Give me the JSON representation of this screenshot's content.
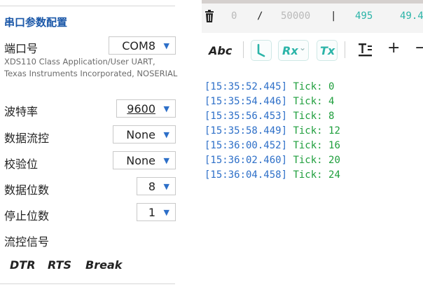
{
  "panel": {
    "title": "串口参数配置",
    "port": {
      "label": "端口号",
      "value": "COM8",
      "description": "XDS110 Class Application/User UART, Texas Instruments Incorporated, NOSERIAL"
    },
    "baud": {
      "label": "波特率",
      "value": "9600"
    },
    "flow_control": {
      "label": "数据流控",
      "value": "None"
    },
    "parity": {
      "label": "校验位",
      "value": "None"
    },
    "data_bits": {
      "label": "数据位数",
      "value": "8"
    },
    "stop_bits": {
      "label": "停止位数",
      "value": "1"
    },
    "flow_signals": {
      "label": "流控信号",
      "dtr": "DTR",
      "rts": "RTS",
      "break": "Break"
    }
  },
  "status": {
    "rx_count": "0",
    "slash": "/",
    "limit": "50000",
    "divider": "|",
    "tx_count": "495",
    "rate": "49.4"
  },
  "toolbar": {
    "abc": "Abc",
    "rx": "Rx",
    "rx_arrow": "⌄",
    "tx": "Tx",
    "plus": "+",
    "minus": "−"
  },
  "log": [
    {
      "ts": "[15:35:52.445]",
      "msg": "Tick: 0"
    },
    {
      "ts": "[15:35:54.446]",
      "msg": "Tick: 4"
    },
    {
      "ts": "[15:35:56.453]",
      "msg": "Tick: 8"
    },
    {
      "ts": "[15:35:58.449]",
      "msg": "Tick: 12"
    },
    {
      "ts": "[15:36:00.452]",
      "msg": "Tick: 16"
    },
    {
      "ts": "[15:36:02.460]",
      "msg": "Tick: 20"
    },
    {
      "ts": "[15:36:04.458]",
      "msg": "Tick: 24"
    }
  ],
  "colors": {
    "accent": "#1a57a8",
    "teal": "#2bb4a8",
    "timestamp": "#2d6fc8",
    "message": "#1e9e3c"
  }
}
